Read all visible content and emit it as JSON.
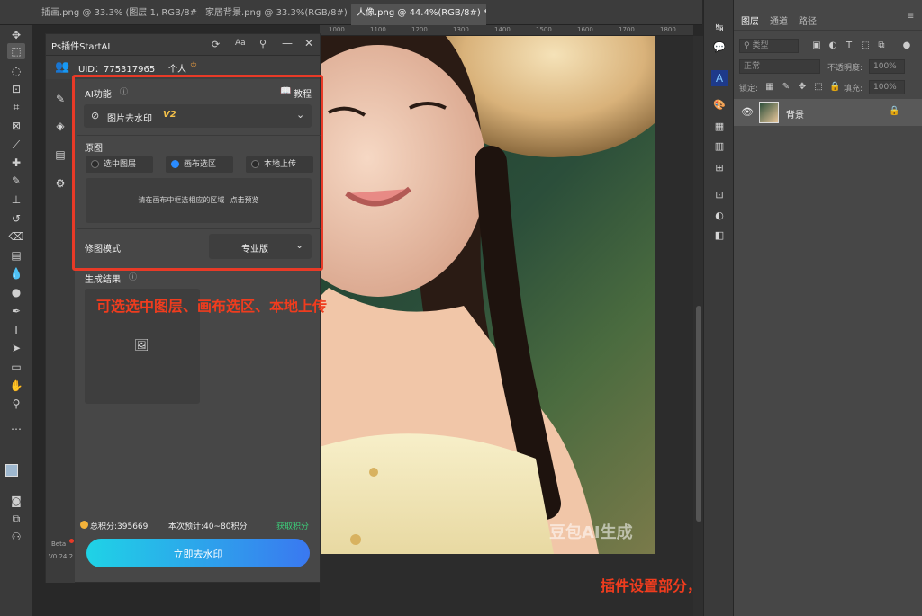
{
  "tabs": [
    {
      "label": "插画.png @ 33.3% (图层 1, RGB/8#) *",
      "close": "×"
    },
    {
      "label": "家居背景.png @ 33.3%(RGB/8#) *",
      "close": "×"
    },
    {
      "label": "人像.png @ 44.4%(RGB/8#) *",
      "close": "×",
      "active": true
    }
  ],
  "ruler_ticks": [
    "1000",
    "1100",
    "1200",
    "1300",
    "1400",
    "1500",
    "1600",
    "1700",
    "1800"
  ],
  "plugin": {
    "title": "Ps插件StartAI",
    "header_icons": [
      "refresh-icon",
      "font-icon",
      "pin-icon",
      "minimize-icon",
      "close-icon"
    ],
    "uid_label": "UID：775317965",
    "account_type": "个人",
    "ai_feature_label": "AI功能",
    "tutorial_label": "教程",
    "feature_selected": "图片去水印",
    "feature_version": "V2",
    "source_label": "原图",
    "source_options": [
      "选中图层",
      "画布选区",
      "本地上传"
    ],
    "source_selected_index": 1,
    "canvas_hint": "请在画布中框选相应的区域",
    "canvas_hint_link": "点击预览",
    "mode_label": "修图模式",
    "mode_value": "专业版",
    "result_label": "生成结果",
    "points_text": "总积分:395669",
    "estimate_text": "本次预计:40~80积分",
    "get_points_label": "获取积分",
    "action_button": "立即去水印",
    "beta_label": "Beta",
    "version_label": "V0.24.2"
  },
  "annotations": {
    "callout_1": "可选选中图层、画布选区、本地上传",
    "callout_2": "插件设置部分，用图片去水印功能"
  },
  "watermark_text": "豆包AI生成",
  "layers_panel": {
    "tabs": [
      "图层",
      "通道",
      "路径"
    ],
    "active_tab": "图层",
    "filter_kind": "类型",
    "blend_mode": "正常",
    "opacity_label": "不透明度:",
    "opacity_value": "100%",
    "lock_label": "锁定:",
    "fill_label": "填充:",
    "fill_value": "100%",
    "layers": [
      {
        "name": "背景",
        "visible": true,
        "locked": true
      }
    ]
  },
  "colors": {
    "accent_red": "#e83a27",
    "button_gradient_start": "#1fd3e6",
    "button_gradient_end": "#3a78f0",
    "link_green": "#3ccf7a",
    "radio_blue": "#2b8cff"
  }
}
